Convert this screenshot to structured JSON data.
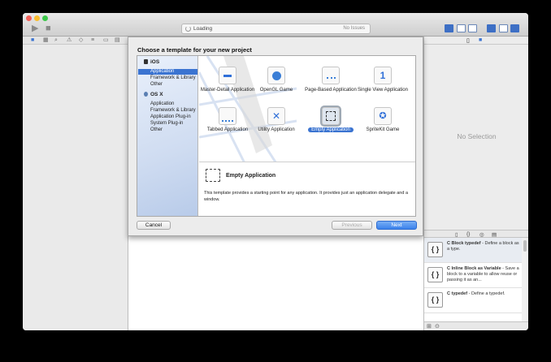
{
  "toolbar": {
    "status": "Loading",
    "issues": "No Issues"
  },
  "icons": {
    "run": "play-icon",
    "stop": "stop-icon",
    "library_block": "{ }"
  },
  "colors": {
    "accent": "#3b74d1",
    "primary_button": "#3b82ec"
  },
  "inspector": {
    "empty_text": "No Selection"
  },
  "library": {
    "items": [
      {
        "title": "C Block typedef",
        "desc": " - Define a block as a type."
      },
      {
        "title": "C Inline Block as Variable",
        "desc": " - Save a block to a variable to allow reuse or passing it as an..."
      },
      {
        "title": "C typedef",
        "desc": " - Define a typedef."
      }
    ]
  },
  "sheet": {
    "title": "Choose a template for your new project",
    "ios_header": "iOS",
    "osx_header": "OS X",
    "ios_items": [
      "Application",
      "Framework & Library",
      "Other"
    ],
    "osx_items": [
      "Application",
      "Framework & Library",
      "Application Plug-in",
      "System Plug-in",
      "Other"
    ],
    "templates": [
      {
        "label": "Master-Detail Application",
        "icon": "master-detail-icon"
      },
      {
        "label": "OpenGL Game",
        "icon": "opengl-icon"
      },
      {
        "label": "Page-Based Application",
        "icon": "page-based-icon"
      },
      {
        "label": "Single View Application",
        "icon": "single-view-icon"
      },
      {
        "label": "Tabbed Application",
        "icon": "tabbed-icon"
      },
      {
        "label": "Utility Application",
        "icon": "utility-icon"
      },
      {
        "label": "Empty Application",
        "icon": "empty-app-icon"
      },
      {
        "label": "SpriteKit Game",
        "icon": "spritekit-icon"
      }
    ],
    "selected_title": "Empty Application",
    "description": "This template provides a starting point for any application. It provides just an application delegate and a window.",
    "cancel": "Cancel",
    "previous": "Previous",
    "next": "Next"
  }
}
